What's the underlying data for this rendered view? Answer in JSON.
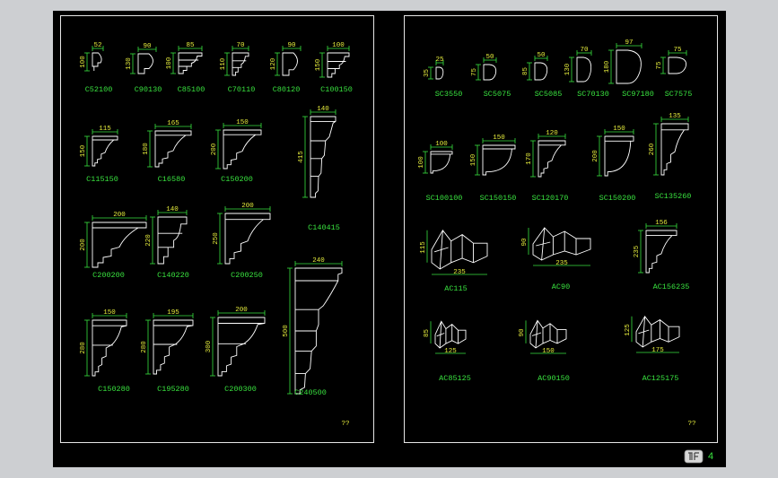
{
  "left_panel": {
    "profiles": [
      {
        "name": "C52100",
        "w": "52",
        "h": "100",
        "kind": "a"
      },
      {
        "name": "C90130",
        "w": "90",
        "h": "130",
        "kind": "b"
      },
      {
        "name": "C85100",
        "w": "85",
        "h": "100",
        "kind": "c"
      },
      {
        "name": "C70110",
        "w": "70",
        "h": "110",
        "kind": "c"
      },
      {
        "name": "C80120",
        "w": "90",
        "h": "120",
        "kind": "b"
      },
      {
        "name": "C100150",
        "w": "100",
        "h": "150",
        "kind": "c"
      },
      {
        "name": "C115150",
        "w": "115",
        "h": "150",
        "kind": "d"
      },
      {
        "name": "C16580",
        "w": "165",
        "h": "180",
        "kind": "d"
      },
      {
        "name": "C150200",
        "w": "150",
        "h": "200",
        "kind": "d"
      },
      {
        "name": "C140415",
        "w": "140",
        "h": "415",
        "kind": "tall"
      },
      {
        "name": "C200200",
        "w": "200",
        "h": "200",
        "kind": "d"
      },
      {
        "name": "C140220",
        "w": "140",
        "h": "220",
        "kind": "c"
      },
      {
        "name": "C200250",
        "w": "200",
        "h": "250",
        "kind": "d"
      },
      {
        "name": "C240500",
        "w": "240",
        "h": "500",
        "kind": "big"
      },
      {
        "name": "C150280",
        "w": "150",
        "h": "280",
        "kind": "e"
      },
      {
        "name": "C195280",
        "w": "195",
        "h": "280",
        "kind": "e"
      },
      {
        "name": "C200300",
        "w": "200",
        "h": "300",
        "kind": "e"
      }
    ],
    "footer_mark": "??"
  },
  "right_panel": {
    "profiles": [
      {
        "name": "SC3550",
        "w": "25",
        "h": "35",
        "kind": "q"
      },
      {
        "name": "SC5075",
        "w": "50",
        "h": "75",
        "kind": "q"
      },
      {
        "name": "SC5085",
        "w": "50",
        "h": "85",
        "kind": "q"
      },
      {
        "name": "SC70130",
        "w": "70",
        "h": "130",
        "kind": "q"
      },
      {
        "name": "SC97180",
        "w": "97",
        "h": "180",
        "kind": "q"
      },
      {
        "name": "SC7575",
        "w": "75",
        "h": "75",
        "kind": "q"
      },
      {
        "name": "SC100100",
        "w": "100",
        "h": "100",
        "kind": "cove"
      },
      {
        "name": "SC150150",
        "w": "150",
        "h": "150",
        "kind": "cove"
      },
      {
        "name": "SC120170",
        "w": "120",
        "h": "170",
        "kind": "d"
      },
      {
        "name": "SC150200",
        "w": "150",
        "h": "200",
        "kind": "cove"
      },
      {
        "name": "SC135260",
        "w": "135",
        "h": "260",
        "kind": "d"
      },
      {
        "name": "AC115",
        "w": "235",
        "h": "115",
        "kind": "iso"
      },
      {
        "name": "AC90",
        "w": "235",
        "h": "90",
        "kind": "iso"
      },
      {
        "name": "AC156235",
        "w": "156",
        "h": "235",
        "kind": "d"
      },
      {
        "name": "AC85125",
        "w": "125",
        "h": "85",
        "kind": "iso"
      },
      {
        "name": "AC90150",
        "w": "150",
        "h": "90",
        "kind": "iso"
      },
      {
        "name": "AC125175",
        "w": "175",
        "h": "125",
        "kind": "iso"
      }
    ],
    "footer_mark": "??"
  },
  "page_number": "4",
  "colors": {
    "label": "#39e23f",
    "dimension": "#e8ef3d",
    "outline": "#ffffff",
    "background": "#000000"
  }
}
